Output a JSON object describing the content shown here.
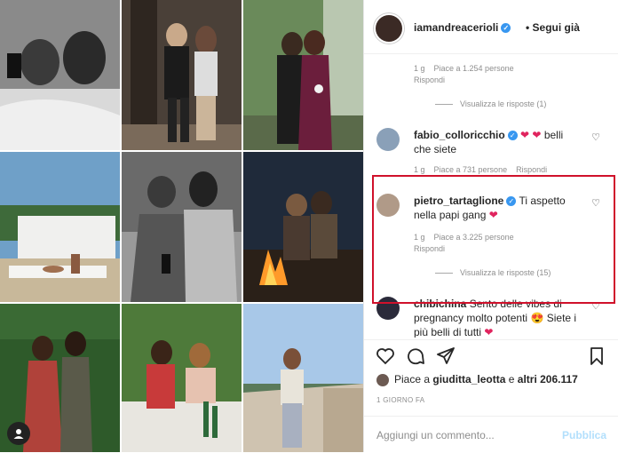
{
  "profile": {
    "username": "iamandreacerioli",
    "follow_label": "Segui già",
    "bullet": "•"
  },
  "comments": [
    {
      "meta_time": "1 g",
      "meta_likes": "Piace a 1.254 persone",
      "reply_label": "Rispondi",
      "view_replies": "Visualizza le risposte (1)"
    },
    {
      "username": "fabio_colloricchio",
      "text_after_emoji": "belli che siete",
      "emoji": "❤ ❤",
      "meta_time": "1 g",
      "meta_likes": "Piace a 731 persone",
      "reply_label": "Rispondi"
    },
    {
      "username": "pietro_tartaglione",
      "text": "Ti aspetto nella papi gang",
      "emoji": "❤",
      "meta_time": "1 g",
      "meta_likes": "Piace a 3.225 persone",
      "reply_label": "Rispondi",
      "view_replies": "Visualizza le risposte (15)"
    },
    {
      "username": "chibichina",
      "text": "Sento delle vibes di pregnancy molto potenti",
      "emoji_mid": "😍",
      "text2": "Siete i più belli di tutti",
      "emoji_end": "❤"
    }
  ],
  "likes": {
    "prefix": "Piace a",
    "user": "giuditta_leotta",
    "connector": "e",
    "others": "altri 206.117"
  },
  "date": "1 GIORNO FA",
  "add_comment": {
    "placeholder": "Aggiungi un commento...",
    "publish": "Pubblica"
  },
  "colors": {
    "highlight": "#d0112b",
    "verified": "#3897f0",
    "heart": "#e0245e",
    "publish": "#b2dffc"
  },
  "icons": [
    "heart-outline-icon",
    "comment-icon",
    "share-icon",
    "bookmark-icon",
    "verified-badge-icon",
    "user-icon"
  ]
}
